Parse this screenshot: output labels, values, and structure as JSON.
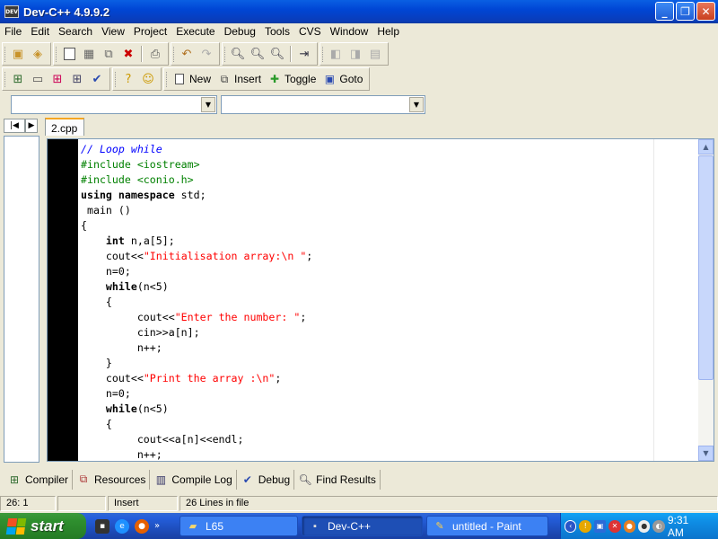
{
  "window": {
    "title": "Dev-C++ 4.9.9.2"
  },
  "menu": [
    "File",
    "Edit",
    "Search",
    "View",
    "Project",
    "Execute",
    "Debug",
    "Tools",
    "CVS",
    "Window",
    "Help"
  ],
  "toolbar2": {
    "new_label": "New",
    "insert_label": "Insert",
    "toggle_label": "Toggle",
    "goto_label": "Goto"
  },
  "file_tab": "2.cpp",
  "left_tabs": [
    "|◀",
    "▶"
  ],
  "code_lines": [
    [
      {
        "c": "cm",
        "t": "// Loop while"
      }
    ],
    [
      {
        "c": "pp",
        "t": "#include <iostream>"
      }
    ],
    [
      {
        "c": "pp",
        "t": "#include <conio.h>"
      }
    ],
    [
      {
        "c": "kw",
        "t": "using namespace"
      },
      {
        "c": "",
        "t": " std;"
      }
    ],
    [
      {
        "c": "",
        "t": " main ()"
      }
    ],
    [
      {
        "c": "",
        "t": "{"
      }
    ],
    [
      {
        "c": "",
        "t": "    "
      },
      {
        "c": "kw",
        "t": "int"
      },
      {
        "c": "",
        "t": " n,a[5];"
      }
    ],
    [
      {
        "c": "",
        "t": "    cout<<"
      },
      {
        "c": "st",
        "t": "\"Initialisation array:\\n \""
      },
      {
        "c": "",
        "t": ";"
      }
    ],
    [
      {
        "c": "",
        "t": "    n=0;"
      }
    ],
    [
      {
        "c": "",
        "t": "    "
      },
      {
        "c": "kw",
        "t": "while"
      },
      {
        "c": "",
        "t": "(n<5)"
      }
    ],
    [
      {
        "c": "",
        "t": "    {"
      }
    ],
    [
      {
        "c": "",
        "t": "         cout<<"
      },
      {
        "c": "st",
        "t": "\"Enter the number: \""
      },
      {
        "c": "",
        "t": ";"
      }
    ],
    [
      {
        "c": "",
        "t": "         cin>>a[n];"
      }
    ],
    [
      {
        "c": "",
        "t": "         n++;"
      }
    ],
    [
      {
        "c": "",
        "t": "    }"
      }
    ],
    [
      {
        "c": "",
        "t": "    cout<<"
      },
      {
        "c": "st",
        "t": "\"Print the array :\\n\""
      },
      {
        "c": "",
        "t": ";"
      }
    ],
    [
      {
        "c": "",
        "t": "    n=0;"
      }
    ],
    [
      {
        "c": "",
        "t": "    "
      },
      {
        "c": "kw",
        "t": "while"
      },
      {
        "c": "",
        "t": "(n<5)"
      }
    ],
    [
      {
        "c": "",
        "t": "    {"
      }
    ],
    [
      {
        "c": "",
        "t": "         cout<<a[n]<<endl;"
      }
    ],
    [
      {
        "c": "",
        "t": "         n++;"
      }
    ]
  ],
  "bottom_tabs": [
    "Compiler",
    "Resources",
    "Compile Log",
    "Debug",
    "Find Results"
  ],
  "status": {
    "position": "26: 1",
    "modified": "",
    "mode": "Insert",
    "lines": "26 Lines in file"
  },
  "taskbar": {
    "start_label": "start",
    "tasks": [
      "L65",
      "Dev-C++",
      "untitled - Paint"
    ],
    "clock": "9:31 AM"
  }
}
